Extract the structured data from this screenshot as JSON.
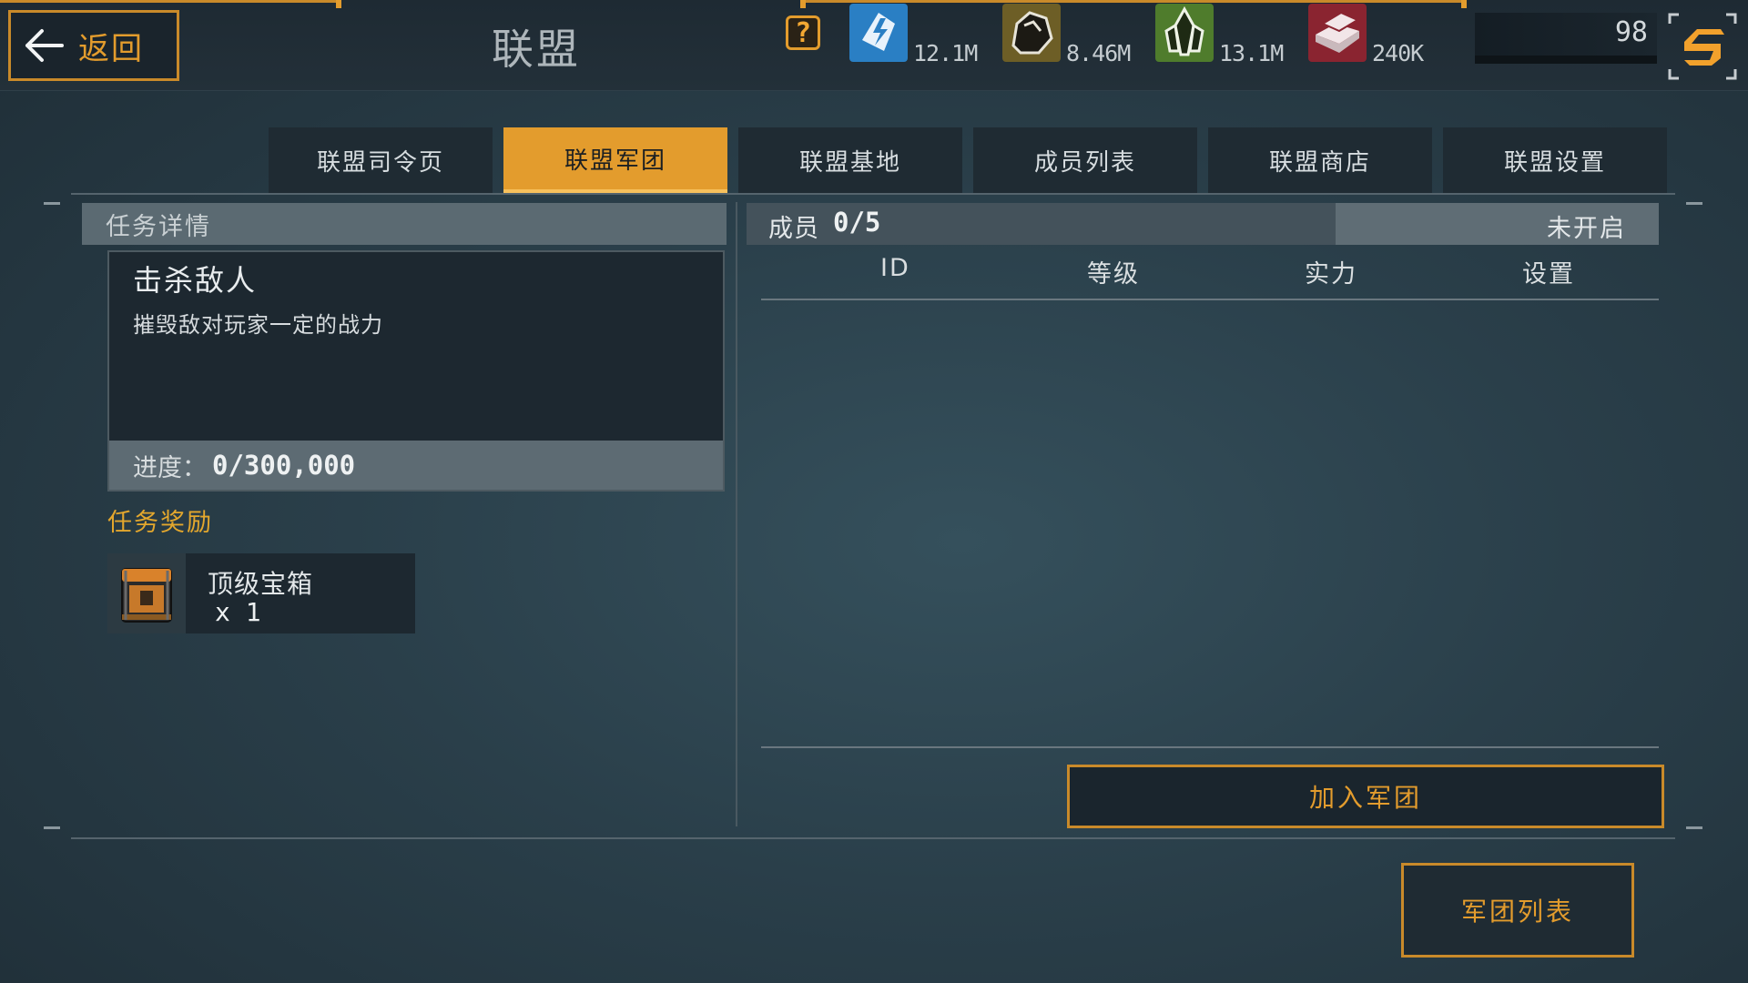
{
  "header": {
    "back_label": "返回",
    "title": "联盟",
    "help_glyph": "?",
    "resources": [
      {
        "name": "energy",
        "icon": "lightning-crystal-icon",
        "value": "12.1M",
        "color": "#2a7fc4"
      },
      {
        "name": "ore",
        "icon": "ore-rock-icon",
        "value": "8.46M",
        "color": "#7a6a2c"
      },
      {
        "name": "crystal",
        "icon": "green-crystal-icon",
        "value": "13.1M",
        "color": "#4f7c2c"
      },
      {
        "name": "alloy",
        "icon": "metal-ingot-icon",
        "value": "240K",
        "color": "#8a2430"
      }
    ],
    "level": "98"
  },
  "tabs": [
    {
      "label": "联盟司令页",
      "active": false
    },
    {
      "label": "联盟军团",
      "active": true
    },
    {
      "label": "联盟基地",
      "active": false
    },
    {
      "label": "成员列表",
      "active": false
    },
    {
      "label": "联盟商店",
      "active": false
    },
    {
      "label": "联盟设置",
      "active": false
    }
  ],
  "task": {
    "section_title": "任务详情",
    "title": "击杀敌人",
    "description": "摧毁敌对玩家一定的战力",
    "progress_label": "进度：",
    "progress_value": "0/300,000",
    "reward_title": "任务奖励",
    "reward": {
      "name": "顶级宝箱",
      "qty": "x 1",
      "icon": "treasure-chest-icon"
    }
  },
  "members": {
    "label": "成员",
    "count": "0/5",
    "status": "未开启",
    "columns": [
      "ID",
      "等级",
      "实力",
      "设置"
    ]
  },
  "buttons": {
    "join": "加入军团",
    "legion_list": "军团列表"
  },
  "colors": {
    "accent": "#e39c2d",
    "panel": "#1d2830"
  }
}
